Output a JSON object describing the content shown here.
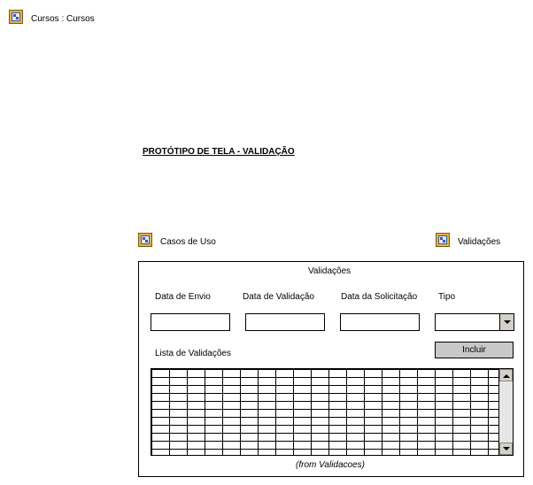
{
  "header": {
    "diagram_label": "Cursos : Cursos",
    "title": "PROTÓTIPO DE TELA - VALIDAÇÃO"
  },
  "links": {
    "use_cases": "Casos de Uso",
    "validations": "Validações"
  },
  "form": {
    "title": "Validações",
    "fields": {
      "data_envio": "Data de Envio",
      "data_validacao": "Data de Validação",
      "data_solicitacao": "Data da Solicitação",
      "tipo": "Tipo"
    },
    "add_button": "Incluir",
    "list_label": "Lista de Validações",
    "footer_note": "(from Validacoes)"
  },
  "icons": {
    "diagram": "diagram-icon"
  }
}
